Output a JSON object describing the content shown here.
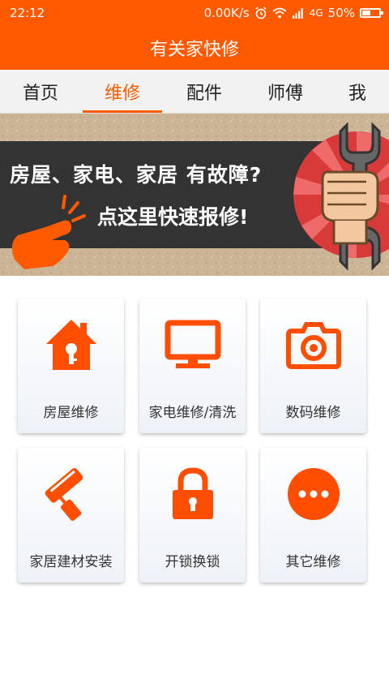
{
  "status_bar": {
    "time": "22:12",
    "network_speed": "0.00K/s",
    "network_type": "4G",
    "battery_text": "50%",
    "battery_level": 0.5,
    "icons": [
      "alarm-icon",
      "wifi-icon",
      "signal-icon",
      "battery-icon"
    ]
  },
  "app": {
    "title": "有关家快修"
  },
  "tabs": [
    {
      "label": "首页",
      "active": false
    },
    {
      "label": "维修",
      "active": true
    },
    {
      "label": "配件",
      "active": false
    },
    {
      "label": "师傅",
      "active": false
    },
    {
      "label": "我",
      "active": false
    }
  ],
  "banner": {
    "line1": "房屋、家电、家居  有故障?",
    "line2": "点这里快速报修!",
    "icons": [
      "pointing-hand-icon",
      "wrench-fist-icon"
    ]
  },
  "services": [
    {
      "label": "房屋维修",
      "icon": "house-icon"
    },
    {
      "label": "家电维修/清洗",
      "icon": "monitor-icon"
    },
    {
      "label": "数码维修",
      "icon": "camera-icon"
    },
    {
      "label": "家居建材安装",
      "icon": "paint-roller-icon"
    },
    {
      "label": "开锁换锁",
      "icon": "lock-icon"
    },
    {
      "label": "其它维修",
      "icon": "more-icon"
    }
  ],
  "colors": {
    "accent": "#ff5a00",
    "tab_bar": "#f2f2f2",
    "banner_band": "#333333"
  }
}
